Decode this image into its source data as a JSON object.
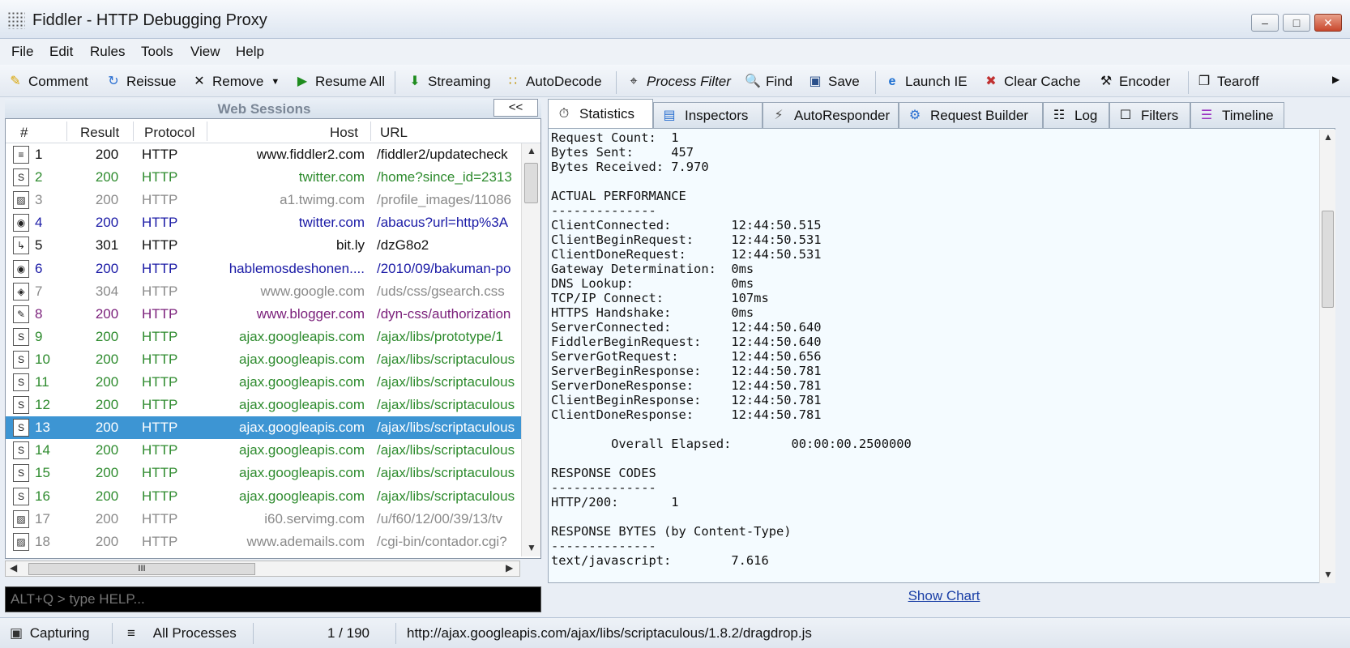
{
  "window": {
    "title": "Fiddler - HTTP Debugging Proxy"
  },
  "menu": [
    "File",
    "Edit",
    "Rules",
    "Tools",
    "View",
    "Help"
  ],
  "toolbar": {
    "comment": "Comment",
    "reissue": "Reissue",
    "remove": "Remove",
    "resume_all": "Resume All",
    "streaming": "Streaming",
    "autodecode": "AutoDecode",
    "process_filter": "Process Filter",
    "find": "Find",
    "save": "Save",
    "launch_ie": "Launch IE",
    "clear_cache": "Clear Cache",
    "encoder": "Encoder",
    "tearoff": "Tearoff"
  },
  "sessions": {
    "title": "Web Sessions",
    "collapse": "<<",
    "columns": [
      "#",
      "Result",
      "Protocol",
      "Host",
      "URL"
    ],
    "rows": [
      {
        "num": "1",
        "result": "200",
        "protocol": "HTTP",
        "host": "www.fiddler2.com",
        "url": "/fiddler2/updatecheck",
        "color": "#111111",
        "icon": "page"
      },
      {
        "num": "2",
        "result": "200",
        "protocol": "HTTP",
        "host": "twitter.com",
        "url": "/home?since_id=2313",
        "color": "#2e8b2e",
        "icon": "script"
      },
      {
        "num": "3",
        "result": "200",
        "protocol": "HTTP",
        "host": "a1.twimg.com",
        "url": "/profile_images/11086",
        "color": "#8a8a8a",
        "icon": "image"
      },
      {
        "num": "4",
        "result": "200",
        "protocol": "HTTP",
        "host": "twitter.com",
        "url": "/abacus?url=http%3A",
        "color": "#1a1aa6",
        "icon": "globe"
      },
      {
        "num": "5",
        "result": "301",
        "protocol": "HTTP",
        "host": "bit.ly",
        "url": "/dzG8o2",
        "color": "#111111",
        "icon": "redirect"
      },
      {
        "num": "6",
        "result": "200",
        "protocol": "HTTP",
        "host": "hablemosdeshonen....",
        "url": "/2010/09/bakuman-po",
        "color": "#1a1aa6",
        "icon": "globe"
      },
      {
        "num": "7",
        "result": "304",
        "protocol": "HTTP",
        "host": "www.google.com",
        "url": "/uds/css/gsearch.css",
        "color": "#8a8a8a",
        "icon": "cache"
      },
      {
        "num": "8",
        "result": "200",
        "protocol": "HTTP",
        "host": "www.blogger.com",
        "url": "/dyn-css/authorization",
        "color": "#7a1f7a",
        "icon": "css"
      },
      {
        "num": "9",
        "result": "200",
        "protocol": "HTTP",
        "host": "ajax.googleapis.com",
        "url": "/ajax/libs/prototype/1",
        "color": "#2e8b2e",
        "icon": "script"
      },
      {
        "num": "10",
        "result": "200",
        "protocol": "HTTP",
        "host": "ajax.googleapis.com",
        "url": "/ajax/libs/scriptaculous",
        "color": "#2e8b2e",
        "icon": "script"
      },
      {
        "num": "11",
        "result": "200",
        "protocol": "HTTP",
        "host": "ajax.googleapis.com",
        "url": "/ajax/libs/scriptaculous",
        "color": "#2e8b2e",
        "icon": "script"
      },
      {
        "num": "12",
        "result": "200",
        "protocol": "HTTP",
        "host": "ajax.googleapis.com",
        "url": "/ajax/libs/scriptaculous",
        "color": "#2e8b2e",
        "icon": "script"
      },
      {
        "num": "13",
        "result": "200",
        "protocol": "HTTP",
        "host": "ajax.googleapis.com",
        "url": "/ajax/libs/scriptaculous",
        "color": "#2e8b2e",
        "icon": "script",
        "selected": true
      },
      {
        "num": "14",
        "result": "200",
        "protocol": "HTTP",
        "host": "ajax.googleapis.com",
        "url": "/ajax/libs/scriptaculous",
        "color": "#2e8b2e",
        "icon": "script"
      },
      {
        "num": "15",
        "result": "200",
        "protocol": "HTTP",
        "host": "ajax.googleapis.com",
        "url": "/ajax/libs/scriptaculous",
        "color": "#2e8b2e",
        "icon": "script"
      },
      {
        "num": "16",
        "result": "200",
        "protocol": "HTTP",
        "host": "ajax.googleapis.com",
        "url": "/ajax/libs/scriptaculous",
        "color": "#2e8b2e",
        "icon": "script"
      },
      {
        "num": "17",
        "result": "200",
        "protocol": "HTTP",
        "host": "i60.servimg.com",
        "url": "/u/f60/12/00/39/13/tv",
        "color": "#8a8a8a",
        "icon": "image"
      },
      {
        "num": "18",
        "result": "200",
        "protocol": "HTTP",
        "host": "www.ademails.com",
        "url": "/cgi-bin/contador.cgi?",
        "color": "#8a8a8a",
        "icon": "image"
      }
    ],
    "hscroll_thumb": "III"
  },
  "quickexec": {
    "placeholder": "ALT+Q > type HELP..."
  },
  "tabs": {
    "statistics": "Statistics",
    "inspectors": "Inspectors",
    "autoresponder": "AutoResponder",
    "request_builder": "Request Builder",
    "log": "Log",
    "filters": "Filters",
    "timeline": "Timeline"
  },
  "statistics_text": "Request Count:  1\nBytes Sent:     457\nBytes Received: 7.970\n\nACTUAL PERFORMANCE\n--------------\nClientConnected:        12:44:50.515\nClientBeginRequest:     12:44:50.531\nClientDoneRequest:      12:44:50.531\nGateway Determination:  0ms\nDNS Lookup:             0ms\nTCP/IP Connect:         107ms\nHTTPS Handshake:        0ms\nServerConnected:        12:44:50.640\nFiddlerBeginRequest:    12:44:50.640\nServerGotRequest:       12:44:50.656\nServerBeginResponse:    12:44:50.781\nServerDoneResponse:     12:44:50.781\nClientBeginResponse:    12:44:50.781\nClientDoneResponse:     12:44:50.781\n\n        Overall Elapsed:        00:00:00.2500000\n\nRESPONSE CODES\n--------------\nHTTP/200:       1\n\nRESPONSE BYTES (by Content-Type)\n--------------\ntext/javascript:        7.616",
  "show_chart": "Show Chart",
  "statusbar": {
    "capturing": "Capturing",
    "processes": "All Processes",
    "count": "1 / 190",
    "url": "http://ajax.googleapis.com/ajax/libs/scriptaculous/1.8.2/dragdrop.js"
  }
}
